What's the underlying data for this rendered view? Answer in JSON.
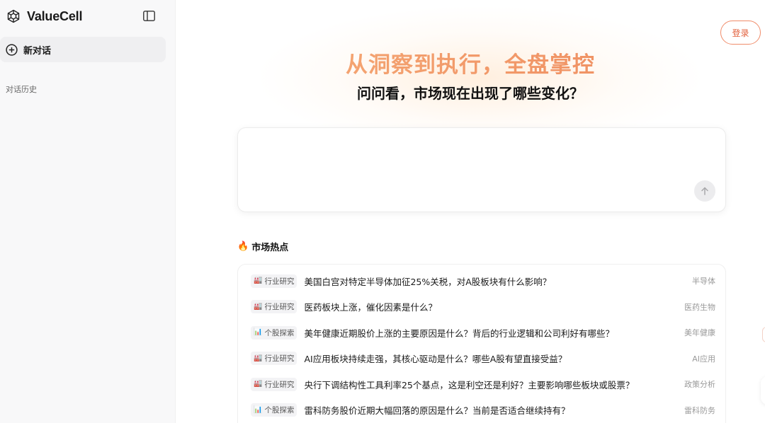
{
  "sidebar": {
    "brand": "ValueCell",
    "new_chat_label": "新对话",
    "history_title": "对话历史"
  },
  "header": {
    "login_label": "登录"
  },
  "hero": {
    "title": "从洞察到执行，全盘掌控",
    "subtitle": "问问看，市场现在出现了哪些变化？"
  },
  "input": {
    "value": "",
    "placeholder": ""
  },
  "hot": {
    "title": "市场热点",
    "items": [
      {
        "tag": "行业研究",
        "tag_icon": "factory-icon",
        "question": "美国白宫对特定半导体加征25%关税，对A股板块有什么影响？",
        "category": "半导体"
      },
      {
        "tag": "行业研究",
        "tag_icon": "factory-icon",
        "question": "医药板块上涨，催化因素是什么？",
        "category": "医药生物"
      },
      {
        "tag": "个股探索",
        "tag_icon": "bar-chart-icon",
        "question": "美年健康近期股价上涨的主要原因是什么？背后的行业逻辑和公司利好有哪些？",
        "category": "美年健康"
      },
      {
        "tag": "行业研究",
        "tag_icon": "factory-icon",
        "question": "AI应用板块持续走强，其核心驱动是什么？哪些A股有望直接受益？",
        "category": "AI应用"
      },
      {
        "tag": "行业研究",
        "tag_icon": "factory-icon",
        "question": "央行下调结构性工具利率25个基点，这是利空还是利好？主要影响哪些板块或股票？",
        "category": "政策分析"
      },
      {
        "tag": "个股探索",
        "tag_icon": "bar-chart-icon",
        "question": "雷科防务股价近期大幅回落的原因是什么？当前是否适合继续持有？",
        "category": "雷科防务"
      }
    ]
  },
  "colors": {
    "accent": "#ee8a5e",
    "login_border": "#f08c6a",
    "sidebar_bg": "#f8f8f9"
  }
}
